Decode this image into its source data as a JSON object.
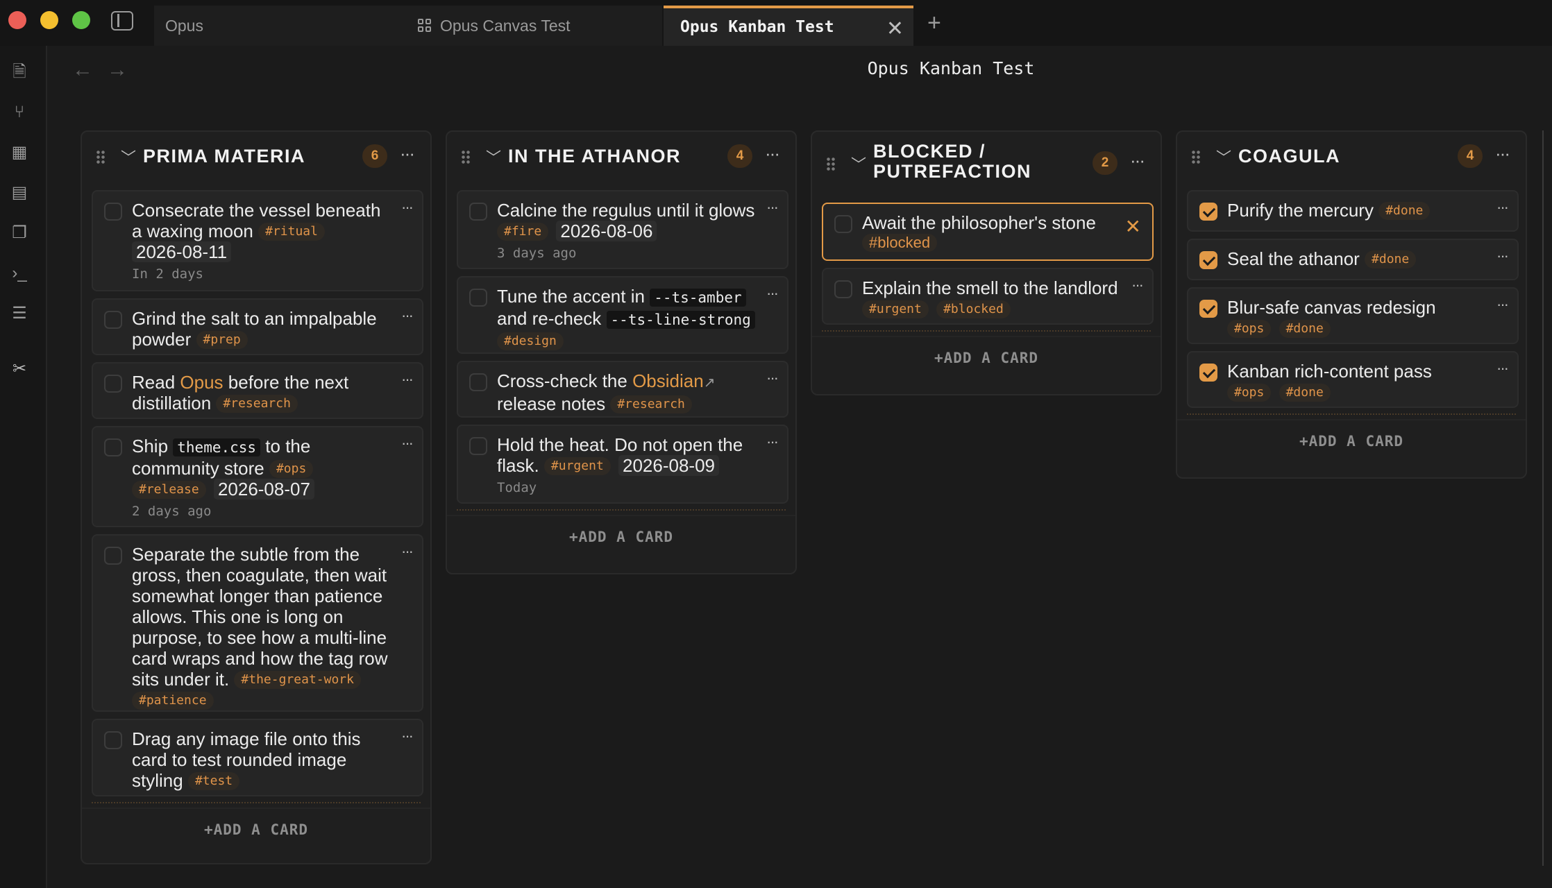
{
  "tabs": [
    {
      "label": "Opus"
    },
    {
      "label": "Opus Canvas Test"
    },
    {
      "label": "Opus Kanban Test"
    }
  ],
  "view_title": "Opus Kanban Test",
  "lanes": [
    {
      "title": "PRIMA MATERIA",
      "count": "6",
      "add_label": "+ADD A CARD",
      "cards": [
        {
          "text": "Consecrate the vessel beneath a waxing moon",
          "tags": [
            "#ritual"
          ],
          "date": "2026-08-11",
          "relative": "In 2 days"
        },
        {
          "text": "Grind the salt to an impalpable powder",
          "tags": [
            "#prep"
          ]
        },
        {
          "pre": "Read ",
          "link": "Opus",
          "post": " before the next distillation",
          "tags": [
            "#research"
          ]
        },
        {
          "pre": "Ship ",
          "code": "theme.css",
          "post": " to the community store",
          "tags": [
            "#ops",
            "#release"
          ],
          "date": "2026-08-07",
          "relative": "2 days ago"
        },
        {
          "text": "Separate the subtle from the gross, then coagulate, then wait somewhat longer than patience allows. This one is long on purpose, to see how a multi-line card wraps and how the tag row sits under it.",
          "tags": [
            "#the-great-work",
            "#patience"
          ]
        },
        {
          "text": "Drag any image file onto this card to test rounded image styling",
          "tags": [
            "#test"
          ]
        }
      ]
    },
    {
      "title": "IN THE ATHANOR",
      "count": "4",
      "add_label": "+ADD A CARD",
      "cards": [
        {
          "text": "Calcine the regulus until it glows",
          "tags": [
            "#fire"
          ],
          "date": "2026-08-06",
          "relative": "3 days ago"
        },
        {
          "pre": "Tune the accent in ",
          "code": "--ts-amber",
          "mid": " and re-check ",
          "code2": "--ts-line-strong",
          "tags": [
            "#design"
          ]
        },
        {
          "pre": "Cross-check the ",
          "link": "Obsidian",
          "post": " release notes",
          "tags": [
            "#research"
          ]
        },
        {
          "text": "Hold the heat. Do not open the flask.",
          "tags": [
            "#urgent"
          ],
          "date": "2026-08-09",
          "relative": "Today"
        }
      ]
    },
    {
      "title": "BLOCKED / PUTREFACTION",
      "count": "2",
      "add_label": "+ADD A CARD",
      "cards": [
        {
          "text": "Await the philosopher's stone",
          "tags": [
            "#blocked"
          ]
        },
        {
          "text": "Explain the smell to the landlord",
          "tags": [
            "#urgent",
            "#blocked"
          ]
        }
      ]
    },
    {
      "title": "COAGULA",
      "count": "4",
      "add_label": "+ADD A CARD",
      "cards": [
        {
          "text": "Purify the mercury",
          "tags": [
            "#done"
          ]
        },
        {
          "text": "Seal the athanor",
          "tags": [
            "#done"
          ]
        },
        {
          "text": "Blur-safe canvas redesign",
          "tags": [
            "#ops",
            "#done"
          ]
        },
        {
          "text": "Kanban rich-content pass",
          "tags": [
            "#ops",
            "#done"
          ]
        }
      ]
    }
  ],
  "colors": {
    "accent": "#e39a47",
    "background": "#1b1b1b",
    "card": "#252525"
  }
}
